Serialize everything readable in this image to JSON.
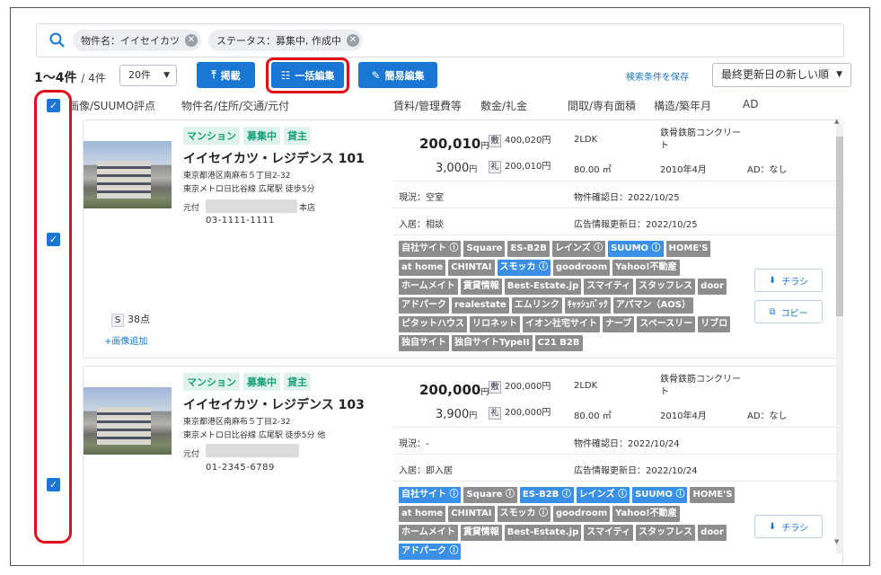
{
  "search": {
    "chips": [
      "物件名：イイセイカツ",
      "ステータス：募集中, 作成中"
    ]
  },
  "toolbar": {
    "count_main": "1〜4件",
    "count_total": "/ 4件",
    "per_page": "20件",
    "btn_publish": "掲載",
    "btn_bulk_edit": "一括編集",
    "btn_quick_edit": "簡易編集",
    "save_search": "検索条件を保存",
    "sort": "最終更新日の新しい順"
  },
  "columns": [
    "画像/SUUMO評点",
    "物件名/住所/交通/元付",
    "賃料/管理費等",
    "敷金/礼金",
    "間取/専有面積",
    "構造/築年月",
    "AD"
  ],
  "properties": [
    {
      "tags": [
        "マンション",
        "募集中",
        "貸主"
      ],
      "name": "イイセイカツ・レジデンス 101",
      "address": "東京都港区南麻布５丁目2-32",
      "access": "東京メトロ日比谷線 広尾駅 徒歩5分",
      "motozuke_label": "元付",
      "branch": "本店",
      "phone": "03-1111-1111",
      "suumo_score": "38点",
      "suumo_s": "S",
      "add_image": "+画像追加",
      "rent": "200,010",
      "rent_unit": "円",
      "fee": "3,000",
      "fee_unit": "円",
      "shiki_mark": "敷",
      "shiki": "400,020円",
      "rei_mark": "礼",
      "rei": "200,010円",
      "layout": "2LDK",
      "area": "80.00 ㎡",
      "structure": "鉄骨鉄筋コンクリート",
      "built": "2010年4月",
      "ad": "AD：なし",
      "status": "現況：空室",
      "confirm": "物件確認日：2022/10/25",
      "move_in": "入居：相談",
      "ad_update": "広告情報更新日：2022/10/25",
      "portals": [
        {
          "label": "自社サイト",
          "info": true,
          "active": false
        },
        {
          "label": "Square",
          "info": false,
          "active": false
        },
        {
          "label": "ES-B2B",
          "info": false,
          "active": false
        },
        {
          "label": "レインズ",
          "info": true,
          "active": false
        },
        {
          "label": "SUUMO",
          "info": true,
          "active": true
        },
        {
          "label": "HOME'S",
          "info": false,
          "active": false
        },
        {
          "label": "at home",
          "info": false,
          "active": false
        },
        {
          "label": "CHINTAI",
          "info": false,
          "active": false
        },
        {
          "label": "スモッカ",
          "info": true,
          "active": true
        },
        {
          "label": "goodroom",
          "info": false,
          "active": false
        },
        {
          "label": "Yahoo!不動産",
          "info": false,
          "active": false
        },
        {
          "label": "ホームメイト",
          "info": false,
          "active": false
        },
        {
          "label": "賃貸情報",
          "info": false,
          "active": false
        },
        {
          "label": "Best-Estate.jp",
          "info": false,
          "active": false
        },
        {
          "label": "スマイティ",
          "info": false,
          "active": false
        },
        {
          "label": "スタッフレス",
          "info": false,
          "active": false
        },
        {
          "label": "door",
          "info": false,
          "active": false
        },
        {
          "label": "アドパーク",
          "info": false,
          "active": false
        },
        {
          "label": "realestate",
          "info": false,
          "active": false
        },
        {
          "label": "エムリンク",
          "info": false,
          "active": false
        },
        {
          "label": "ｷｬｯｼｭﾊﾞｯｸ",
          "info": false,
          "active": false
        },
        {
          "label": "アパマン（AOS）",
          "info": false,
          "active": false
        },
        {
          "label": "ピタットハウス",
          "info": false,
          "active": false
        },
        {
          "label": "リロネット",
          "info": false,
          "active": false
        },
        {
          "label": "イオン社宅サイト",
          "info": false,
          "active": false
        },
        {
          "label": "ナーブ",
          "info": false,
          "active": false
        },
        {
          "label": "スペースリー",
          "info": false,
          "active": false
        },
        {
          "label": "リブロ",
          "info": false,
          "active": false
        },
        {
          "label": "独自サイト",
          "info": false,
          "active": false
        },
        {
          "label": "独自サイトTypeII",
          "info": false,
          "active": false
        },
        {
          "label": "C21 B2B",
          "info": false,
          "active": false
        }
      ],
      "btn_flyer": "チラシ",
      "btn_copy": "コピー"
    },
    {
      "tags": [
        "マンション",
        "募集中",
        "貸主"
      ],
      "name": "イイセイカツ・レジデンス 103",
      "address": "東京都港区南麻布５丁目2-32",
      "access": "東京メトロ日比谷線 広尾駅 徒歩5分 他",
      "motozuke_label": "元付",
      "phone": "01-2345-6789",
      "rent": "200,000",
      "rent_unit": "円",
      "fee": "3,900",
      "fee_unit": "円",
      "shiki_mark": "敷",
      "shiki": "200,000円",
      "rei_mark": "礼",
      "rei": "200,000円",
      "layout": "2LDK",
      "area": "80.00 ㎡",
      "structure": "鉄骨鉄筋コンクリート",
      "built": "2010年4月",
      "ad": "AD：なし",
      "status": "現況：-",
      "confirm": "物件確認日：2022/10/24",
      "move_in": "入居：即入居",
      "ad_update": "広告情報更新日：2022/10/24",
      "portals": [
        {
          "label": "自社サイト",
          "info": true,
          "active": true
        },
        {
          "label": "Square",
          "info": true,
          "active": false
        },
        {
          "label": "ES-B2B",
          "info": true,
          "active": true
        },
        {
          "label": "レインズ",
          "info": true,
          "active": true
        },
        {
          "label": "SUUMO",
          "info": true,
          "active": true
        },
        {
          "label": "HOME'S",
          "info": false,
          "active": false
        },
        {
          "label": "at home",
          "info": false,
          "active": false
        },
        {
          "label": "CHINTAI",
          "info": false,
          "active": false
        },
        {
          "label": "スモッカ",
          "info": true,
          "active": false
        },
        {
          "label": "goodroom",
          "info": false,
          "active": false
        },
        {
          "label": "Yahoo!不動産",
          "info": false,
          "active": false
        },
        {
          "label": "ホームメイト",
          "info": false,
          "active": false
        },
        {
          "label": "賃貸情報",
          "info": false,
          "active": false
        },
        {
          "label": "Best-Estate.jp",
          "info": false,
          "active": false
        },
        {
          "label": "スマイティ",
          "info": false,
          "active": false
        },
        {
          "label": "スタッフレス",
          "info": false,
          "active": false
        },
        {
          "label": "door",
          "info": false,
          "active": false
        },
        {
          "label": "アドパーク",
          "info": true,
          "active": true
        }
      ],
      "btn_flyer": "チラシ"
    }
  ]
}
